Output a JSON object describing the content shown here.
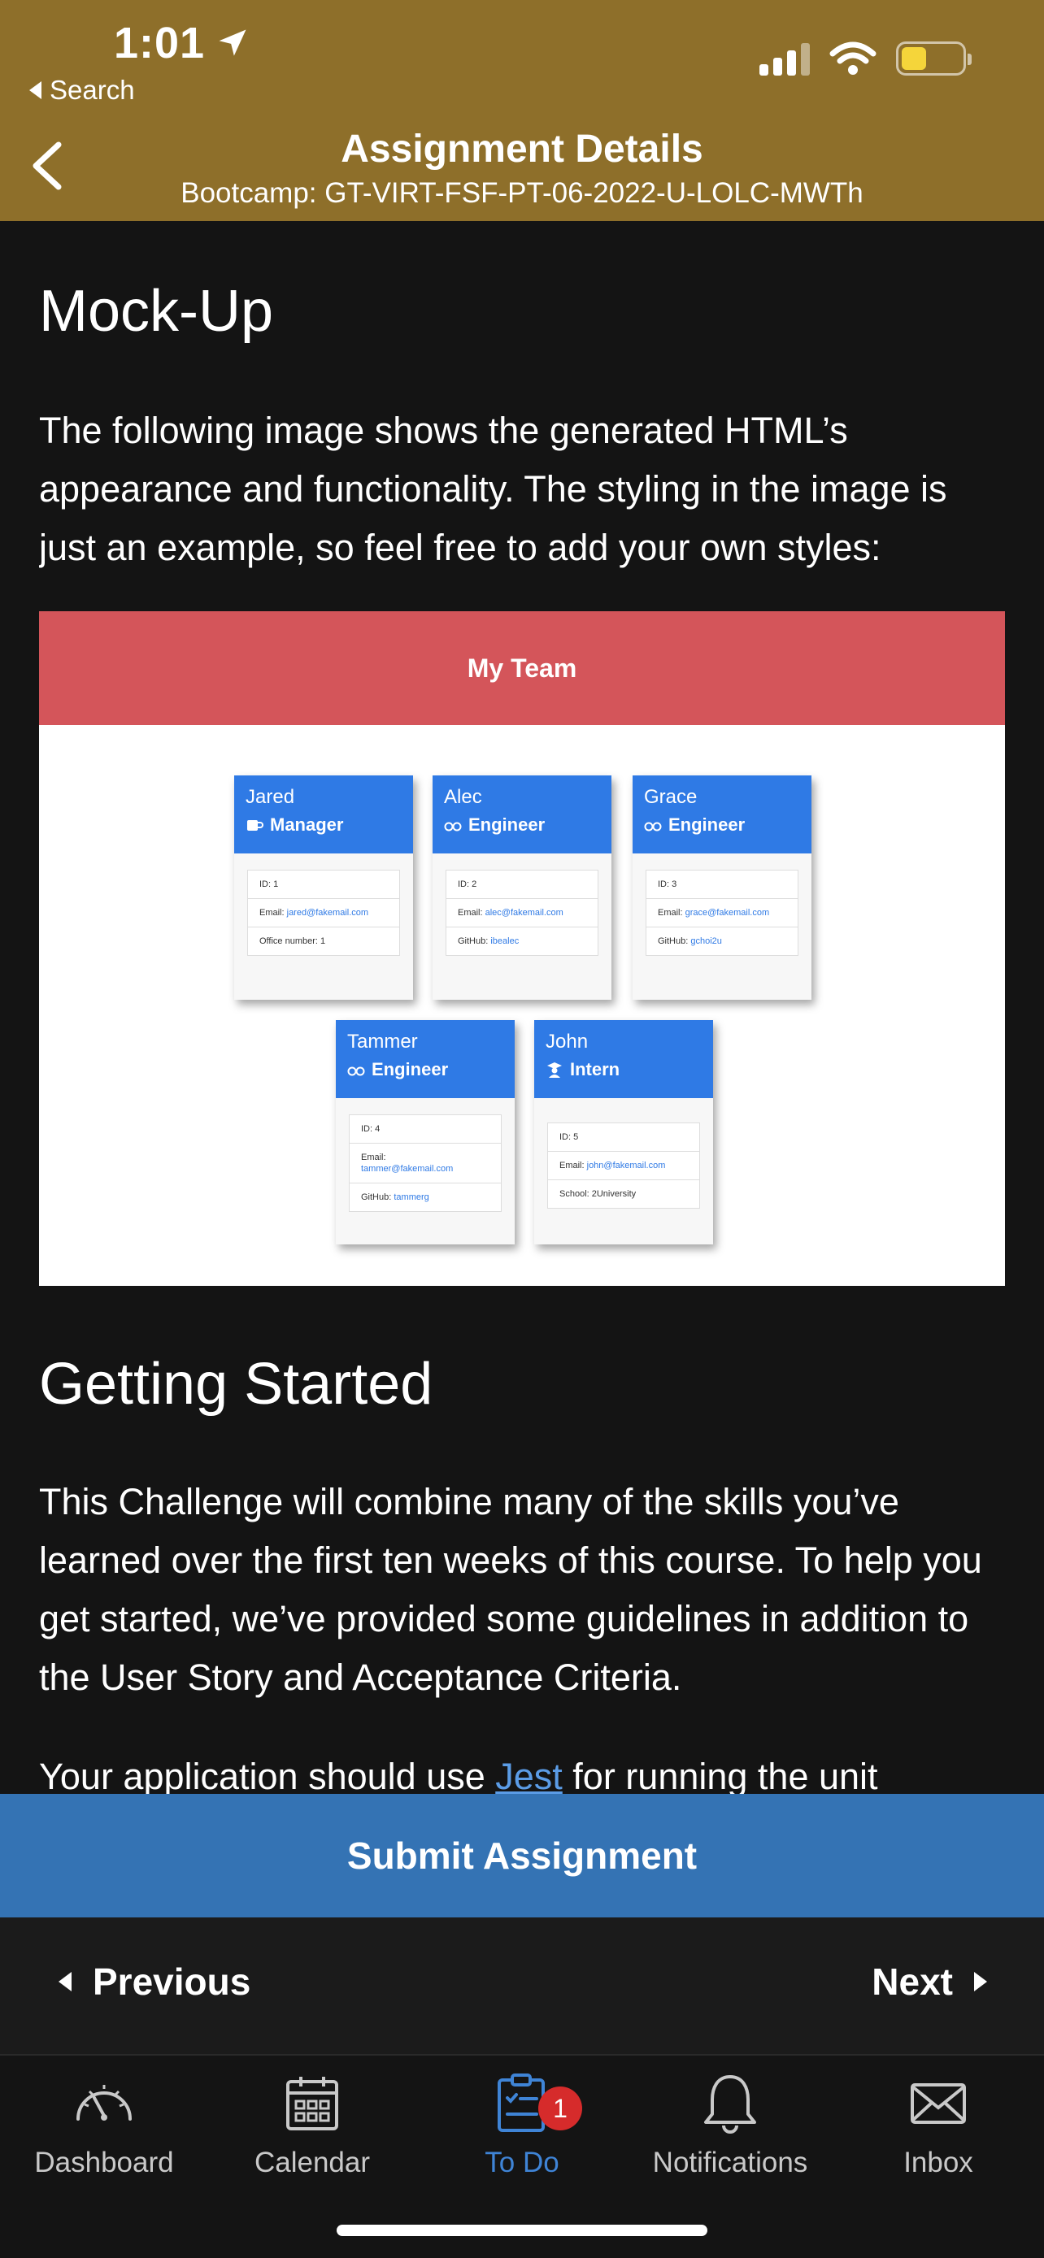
{
  "status": {
    "time": "1:01",
    "back_app": "Search"
  },
  "colors": {
    "header": "#8e6f2a",
    "submit": "#3473b4",
    "active_tab": "#3f84d6",
    "badge": "#d62b2b"
  },
  "nav": {
    "title": "Assignment Details",
    "subtitle": "Bootcamp: GT-VIRT-FSF-PT-06-2022-U-LOLC-MWTh"
  },
  "content": {
    "mockup_heading": "Mock-Up",
    "mockup_text": "The following image shows the generated HTML’s appearance and functionality. The styling in the image is just an example, so feel free to add your own styles:",
    "getting_started_heading": "Getting Started",
    "getting_started_text": "This Challenge will combine many of the skills you’ve learned over the first ten weeks of this course. To help you get started, we’ve provided some guidelines in addition to the User Story and Acceptance Criteria.",
    "jest_prefix": "Your application should use ",
    "jest_link": "Jest",
    "jest_suffix": " for running the unit"
  },
  "mockup_image": {
    "title": "My Team",
    "cards": [
      {
        "name": "Jared",
        "role": "Manager",
        "icon": "mug-icon",
        "id": "ID: 1",
        "email_label": "Email: ",
        "email": "jared@fakemail.com",
        "extra_label": "Office number: 1",
        "extra_link": ""
      },
      {
        "name": "Alec",
        "role": "Engineer",
        "icon": "glasses-icon",
        "id": "ID: 2",
        "email_label": "Email: ",
        "email": "alec@fakemail.com",
        "extra_label": "GitHub: ",
        "extra_link": "ibealec"
      },
      {
        "name": "Grace",
        "role": "Engineer",
        "icon": "glasses-icon",
        "id": "ID: 3",
        "email_label": "Email: ",
        "email": "grace@fakemail.com",
        "extra_label": "GitHub: ",
        "extra_link": "gchoi2u"
      },
      {
        "name": "Tammer",
        "role": "Engineer",
        "icon": "glasses-icon",
        "id": "ID: 4",
        "email_label": "Email:",
        "email": "tammer@fakemail.com",
        "extra_label": "GitHub: ",
        "extra_link": "tammerg"
      },
      {
        "name": "John",
        "role": "Intern",
        "icon": "graduate-icon",
        "id": "ID: 5",
        "email_label": "Email: ",
        "email": "john@fakemail.com",
        "extra_label": "School: 2University",
        "extra_link": ""
      }
    ]
  },
  "submit_label": "Submit Assignment",
  "pager": {
    "previous": "Previous",
    "next": "Next"
  },
  "tabs": [
    {
      "label": "Dashboard",
      "icon": "speedometer-icon"
    },
    {
      "label": "Calendar",
      "icon": "calendar-icon"
    },
    {
      "label": "To Do",
      "icon": "clipboard-icon",
      "badge": "1"
    },
    {
      "label": "Notifications",
      "icon": "bell-icon"
    },
    {
      "label": "Inbox",
      "icon": "envelope-icon"
    }
  ]
}
